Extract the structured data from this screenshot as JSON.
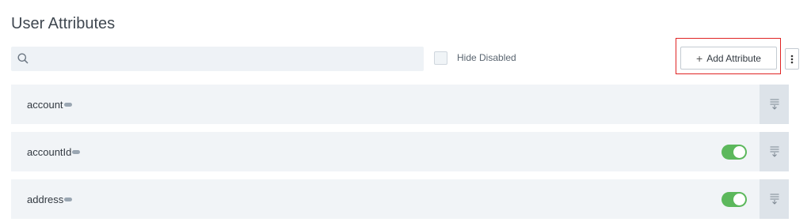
{
  "page": {
    "title": "User Attributes"
  },
  "search": {
    "placeholder": "",
    "value": ""
  },
  "filters": {
    "hide_disabled_label": "Hide Disabled",
    "hide_disabled_checked": false
  },
  "toolbar": {
    "add_label": "Add Attribute",
    "add_icon": "plus-icon",
    "more_icon": "vertical-ellipsis-icon"
  },
  "attributes": [
    {
      "name": "account",
      "enabled": null
    },
    {
      "name": "accountId",
      "enabled": true
    },
    {
      "name": "address",
      "enabled": true
    }
  ],
  "colors": {
    "toggle_on": "#5cb85c",
    "highlight": "#e02424",
    "row_bg": "#f1f4f7"
  }
}
